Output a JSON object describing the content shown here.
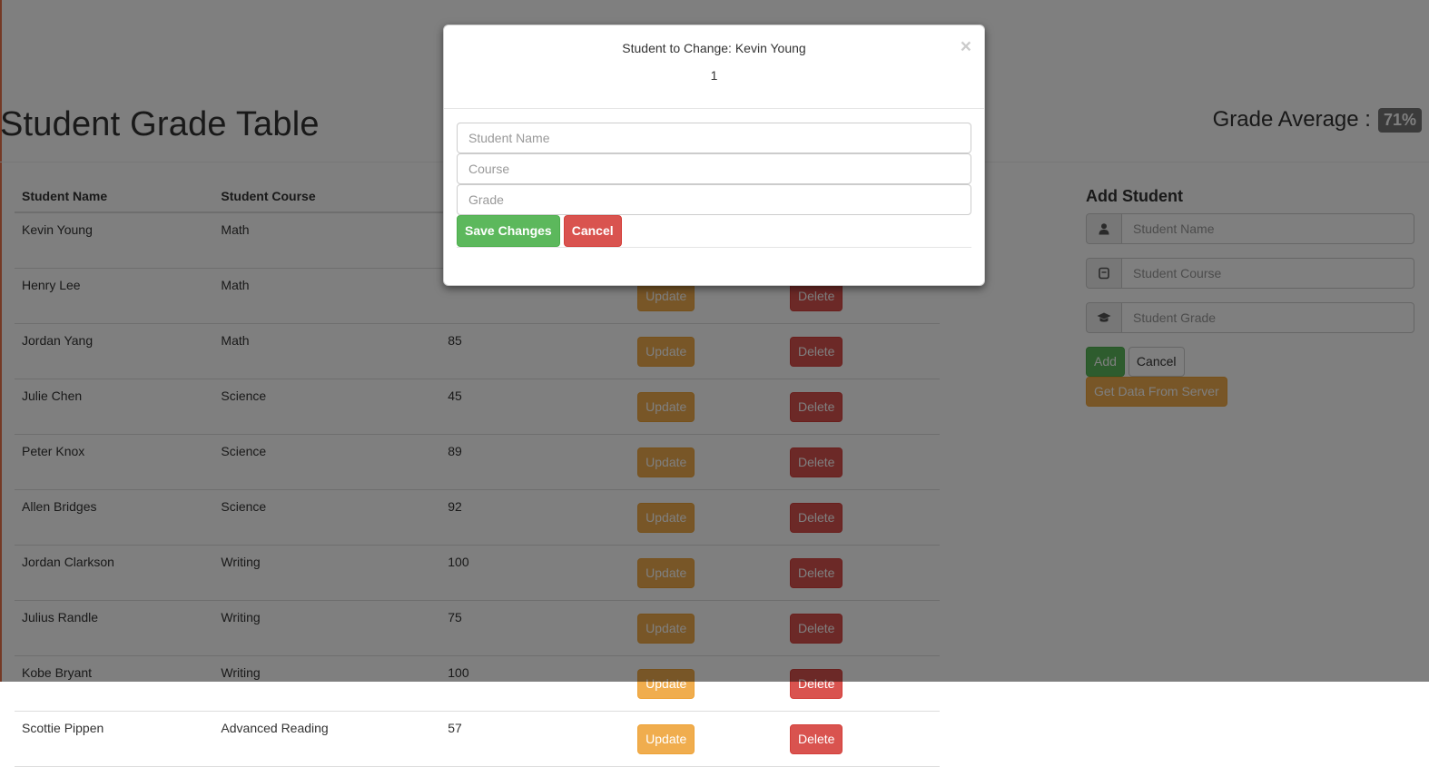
{
  "header": {
    "title": "Student Grade Table",
    "avg_label": "Grade Average :",
    "avg_value": "71%"
  },
  "table": {
    "columns": [
      "Student Name",
      "Student Course"
    ],
    "update_label": "Update",
    "delete_label": "Delete",
    "rows": [
      {
        "name": "Kevin Young",
        "course": "Math",
        "grade": ""
      },
      {
        "name": "Henry Lee",
        "course": "Math",
        "grade": ""
      },
      {
        "name": "Jordan Yang",
        "course": "Math",
        "grade": "85"
      },
      {
        "name": "Julie Chen",
        "course": "Science",
        "grade": "45"
      },
      {
        "name": "Peter Knox",
        "course": "Science",
        "grade": "89"
      },
      {
        "name": "Allen Bridges",
        "course": "Science",
        "grade": "92"
      },
      {
        "name": "Jordan Clarkson",
        "course": "Writing",
        "grade": "100"
      },
      {
        "name": "Julius Randle",
        "course": "Writing",
        "grade": "75"
      },
      {
        "name": "Kobe Bryant",
        "course": "Writing",
        "grade": "100"
      },
      {
        "name": "Scottie Pippen",
        "course": "Advanced Reading",
        "grade": "57"
      }
    ]
  },
  "add_student": {
    "title": "Add Student",
    "name_placeholder": "Student Name",
    "course_placeholder": "Student Course",
    "grade_placeholder": "Student Grade",
    "add_label": "Add",
    "cancel_label": "Cancel",
    "server_label": "Get Data From Server"
  },
  "modal": {
    "title": "Student to Change: Kevin Young",
    "subtitle": "1",
    "close_glyph": "×",
    "name_placeholder": "Student Name",
    "course_placeholder": "Course",
    "grade_placeholder": "Grade",
    "save_label": "Save Changes",
    "cancel_label": "Cancel"
  },
  "icons": {
    "user": "user-icon",
    "course": "book-icon",
    "grade": "graduation-cap-icon"
  }
}
